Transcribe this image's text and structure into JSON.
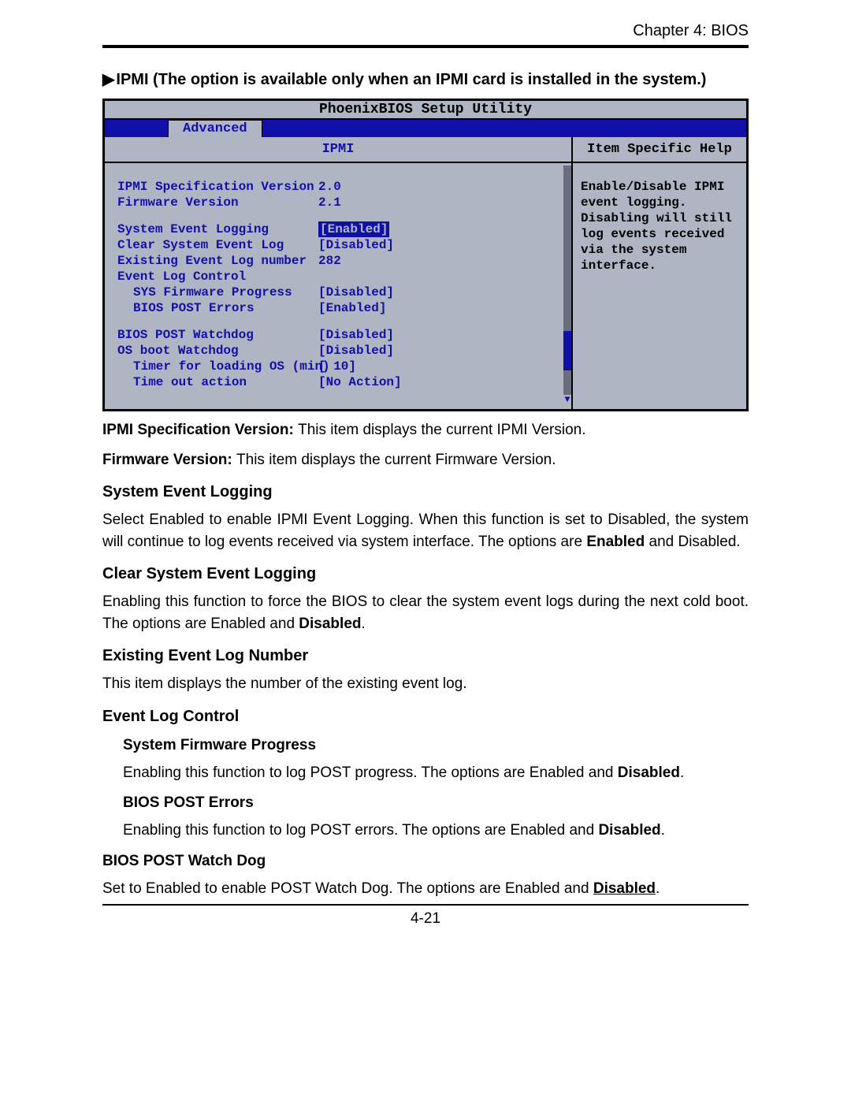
{
  "header": {
    "chapter": "Chapter 4: BIOS"
  },
  "intro": {
    "arrow": "▶",
    "text": "IPMI (The option is available only when an IPMI card is installed in the system.)"
  },
  "bios": {
    "title": "PhoenixBIOS Setup Utility",
    "tab": "Advanced",
    "section": "IPMI",
    "helpHeader": "Item Specific Help",
    "helpText": "Enable/Disable IPMI event logging. Disabling will still log events received via the system interface.",
    "rows": {
      "specVer": {
        "label": "IPMI Specification Version",
        "value": "2.0"
      },
      "fwVer": {
        "label": "Firmware Version",
        "value": "2.1"
      },
      "sysEvtLog": {
        "label": "System Event Logging",
        "value": "[Enabled]"
      },
      "clrSysEvt": {
        "label": "Clear System Event Log",
        "value": "[Disabled]"
      },
      "existLog": {
        "label": "Existing Event Log number",
        "value": "282"
      },
      "evtCtrl": {
        "label": "Event Log Control",
        "value": ""
      },
      "sysFw": {
        "label": "SYS Firmware Progress",
        "value": "[Disabled]"
      },
      "postErr": {
        "label": "BIOS POST Errors",
        "value": "[Enabled]"
      },
      "postWd": {
        "label": "BIOS POST Watchdog",
        "value": "[Disabled]"
      },
      "osWd": {
        "label": "OS boot Watchdog",
        "value": "[Disabled]"
      },
      "timer": {
        "label": "Timer for loading OS (min)",
        "value": "[ 10]"
      },
      "timeout": {
        "label": "Time out action",
        "value": "[No Action]"
      }
    }
  },
  "doc": {
    "ipmiSpec": {
      "bold": "IPMI Specification Version: ",
      "text": "This item displays the current IPMI Version."
    },
    "fwVer": {
      "bold": "Firmware Version: ",
      "text": "This item displays the current Firmware Version."
    },
    "sysEvtLog": {
      "heading": "System Event Logging",
      "p1": "Select Enabled to enable IPMI Event Logging. When this function is set to Disabled, the system will continue to log events received via system interface. The options are ",
      "bold": "Enabled",
      "p2": " and Disabled."
    },
    "clrSys": {
      "heading": "Clear System Event Logging",
      "p1": "Enabling this function to force the BIOS to clear the system event logs during the next cold boot. The options are Enabled and ",
      "bold": "Disabled",
      "p2": "."
    },
    "existLog": {
      "heading": "Existing Event Log Number",
      "p": "This item displays the number of the existing event log."
    },
    "evtCtrl": {
      "heading": "Event Log Control"
    },
    "sysFw": {
      "heading": "System Firmware Progress",
      "p1": "Enabling this function to log POST progress. The options are Enabled and ",
      "bold": "Disabled",
      "p2": "."
    },
    "postErr": {
      "heading": "BIOS POST Errors",
      "p1": "Enabling this function to log POST errors. The options are Enabled and ",
      "bold": "Disabled",
      "p2": "."
    },
    "postWd": {
      "heading": "BIOS POST Watch Dog",
      "p1": "Set to Enabled to enable POST Watch Dog. The options are Enabled and ",
      "bold": "Disabled",
      "p2": "."
    }
  },
  "pageNumber": "4-21"
}
